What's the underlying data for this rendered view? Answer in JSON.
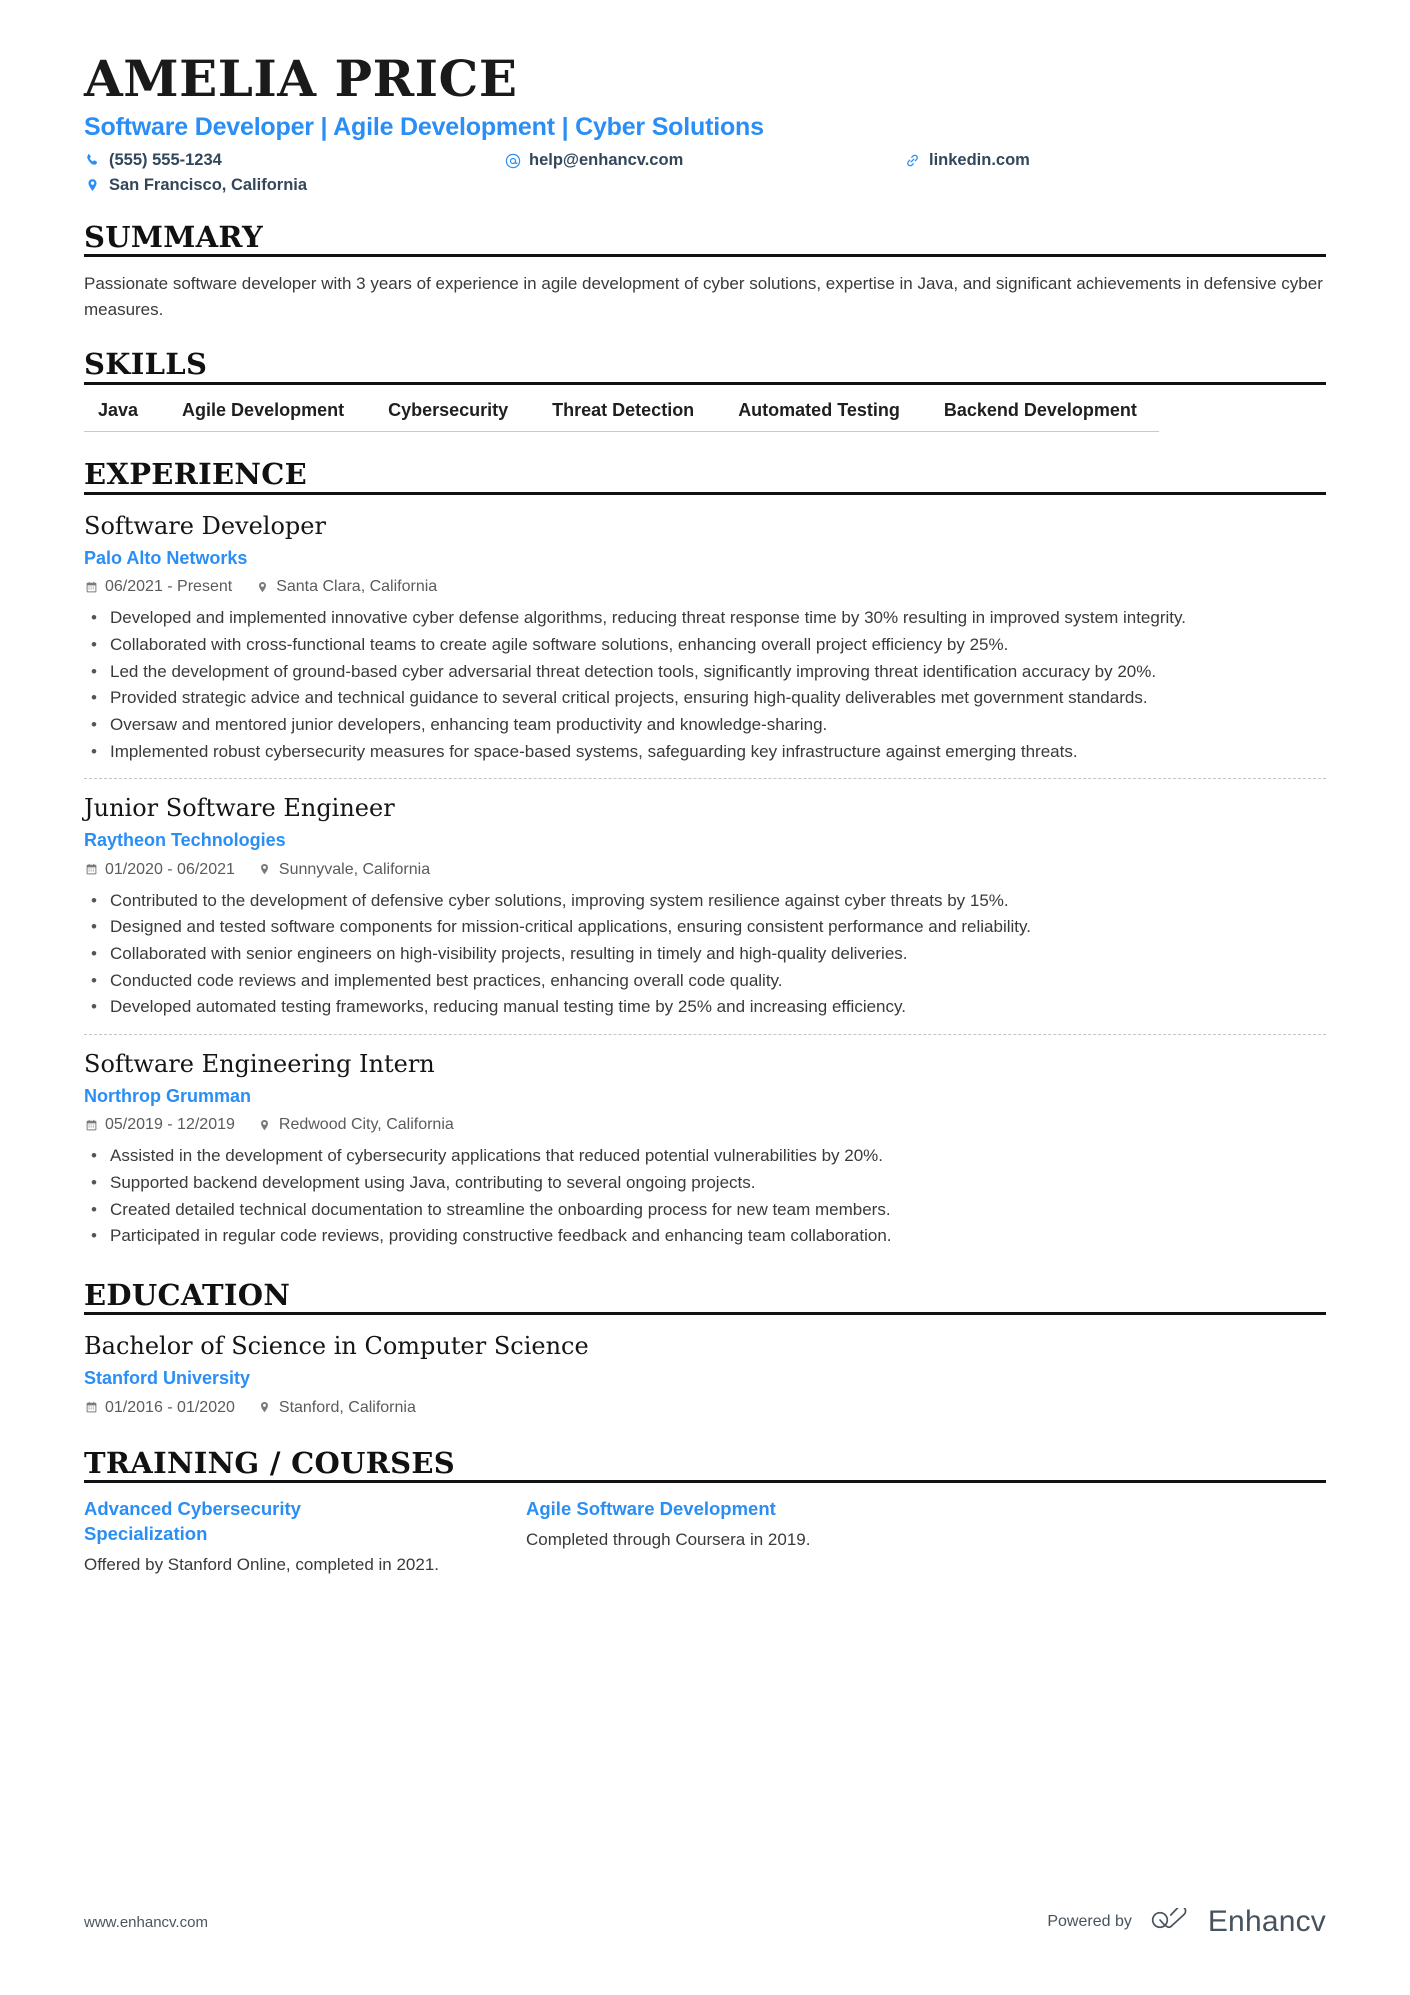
{
  "header": {
    "name": "AMELIA PRICE",
    "headline": "Software Developer | Agile Development | Cyber Solutions",
    "contacts": [
      {
        "icon": "phone-icon",
        "text": "(555) 555-1234"
      },
      {
        "icon": "email-icon",
        "text": "help@enhancv.com"
      },
      {
        "icon": "link-icon",
        "text": "linkedin.com"
      },
      {
        "icon": "location-icon",
        "text": "San Francisco, California"
      }
    ]
  },
  "summary": {
    "title": "SUMMARY",
    "text": "Passionate software developer with 3 years of experience in agile development of cyber solutions, expertise in Java, and significant achievements in defensive cyber measures."
  },
  "skills": {
    "title": "SKILLS",
    "items": [
      "Java",
      "Agile Development",
      "Cybersecurity",
      "Threat Detection",
      "Automated Testing",
      "Backend Development"
    ]
  },
  "experience": {
    "title": "EXPERIENCE",
    "entries": [
      {
        "role": "Software Developer",
        "company": "Palo Alto Networks",
        "dates": "06/2021 - Present",
        "location": "Santa Clara, California",
        "bullets": [
          "Developed and implemented innovative cyber defense algorithms, reducing threat response time by 30% resulting in improved system integrity.",
          "Collaborated with cross-functional teams to create agile software solutions, enhancing overall project efficiency by 25%.",
          "Led the development of ground-based cyber adversarial threat detection tools, significantly improving threat identification accuracy by 20%.",
          "Provided strategic advice and technical guidance to several critical projects, ensuring high-quality deliverables met government standards.",
          "Oversaw and mentored junior developers, enhancing team productivity and knowledge-sharing.",
          "Implemented robust cybersecurity measures for space-based systems, safeguarding key infrastructure against emerging threats."
        ]
      },
      {
        "role": "Junior Software Engineer",
        "company": "Raytheon Technologies",
        "dates": "01/2020 - 06/2021",
        "location": "Sunnyvale, California",
        "bullets": [
          "Contributed to the development of defensive cyber solutions, improving system resilience against cyber threats by 15%.",
          "Designed and tested software components for mission-critical applications, ensuring consistent performance and reliability.",
          "Collaborated with senior engineers on high-visibility projects, resulting in timely and high-quality deliveries.",
          "Conducted code reviews and implemented best practices, enhancing overall code quality.",
          "Developed automated testing frameworks, reducing manual testing time by 25% and increasing efficiency."
        ]
      },
      {
        "role": "Software Engineering Intern",
        "company": "Northrop Grumman",
        "dates": "05/2019 - 12/2019",
        "location": "Redwood City, California",
        "bullets": [
          "Assisted in the development of cybersecurity applications that reduced potential vulnerabilities by 20%.",
          "Supported backend development using Java, contributing to several ongoing projects.",
          "Created detailed technical documentation to streamline the onboarding process for new team members.",
          "Participated in regular code reviews, providing constructive feedback and enhancing team collaboration."
        ]
      }
    ]
  },
  "education": {
    "title": "EDUCATION",
    "entries": [
      {
        "degree": "Bachelor of Science in Computer Science",
        "school": "Stanford University",
        "dates": "01/2016 - 01/2020",
        "location": "Stanford, California"
      }
    ]
  },
  "training": {
    "title": "TRAINING / COURSES",
    "courses": [
      {
        "name": "Advanced Cybersecurity Specialization",
        "description": "Offered by Stanford Online, completed in 2021."
      },
      {
        "name": "Agile Software Development",
        "description": "Completed through Coursera in 2019."
      }
    ]
  },
  "footer": {
    "url": "www.enhancv.com",
    "powered_by": "Powered by",
    "brand": "Enhancv"
  },
  "colors": {
    "accent": "#2a8ef5",
    "heading": "#111111",
    "body": "#3a3a3a",
    "meta": "#5b5b5b"
  }
}
